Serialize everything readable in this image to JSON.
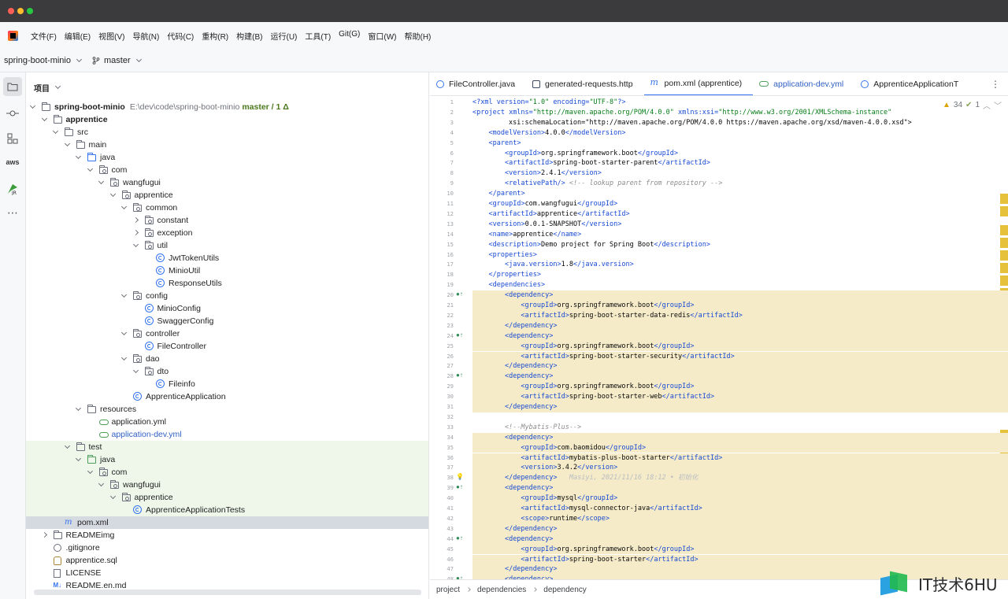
{
  "menu": [
    "文件(F)",
    "编辑(E)",
    "视图(V)",
    "导航(N)",
    "代码(C)",
    "重构(R)",
    "构建(B)",
    "运行(U)",
    "工具(T)",
    "Git(G)",
    "窗口(W)",
    "帮助(H)"
  ],
  "toolbar": {
    "project_name": "spring-boot-minio",
    "branch": "master"
  },
  "project_panel": {
    "title": "项目"
  },
  "tree": [
    {
      "depth": 0,
      "arrow": "open",
      "icon": "folder",
      "label": "spring-boot-minio",
      "bold": true,
      "hint": "E:\\dev\\code\\spring-boot-minio",
      "branch": "master / 1 Δ"
    },
    {
      "depth": 1,
      "arrow": "open",
      "icon": "folder",
      "label": "apprentice",
      "bold": true
    },
    {
      "depth": 2,
      "arrow": "open",
      "icon": "folder",
      "label": "src"
    },
    {
      "depth": 3,
      "arrow": "open",
      "icon": "folder",
      "label": "main"
    },
    {
      "depth": 4,
      "arrow": "open",
      "icon": "folder-blue",
      "label": "java"
    },
    {
      "depth": 5,
      "arrow": "open",
      "icon": "pkg",
      "label": "com"
    },
    {
      "depth": 6,
      "arrow": "open",
      "icon": "pkg",
      "label": "wangfugui"
    },
    {
      "depth": 7,
      "arrow": "open",
      "icon": "pkg",
      "label": "apprentice"
    },
    {
      "depth": 8,
      "arrow": "open",
      "icon": "pkg",
      "label": "common"
    },
    {
      "depth": 9,
      "arrow": "closed",
      "icon": "pkg",
      "label": "constant"
    },
    {
      "depth": 9,
      "arrow": "closed",
      "icon": "pkg",
      "label": "exception"
    },
    {
      "depth": 9,
      "arrow": "open",
      "icon": "pkg",
      "label": "util"
    },
    {
      "depth": 10,
      "arrow": "",
      "icon": "class",
      "label": "JwtTokenUtils"
    },
    {
      "depth": 10,
      "arrow": "",
      "icon": "class",
      "label": "MinioUtil"
    },
    {
      "depth": 10,
      "arrow": "",
      "icon": "class",
      "label": "ResponseUtils"
    },
    {
      "depth": 8,
      "arrow": "open",
      "icon": "pkg",
      "label": "config"
    },
    {
      "depth": 9,
      "arrow": "",
      "icon": "class",
      "label": "MinioConfig"
    },
    {
      "depth": 9,
      "arrow": "",
      "icon": "class",
      "label": "SwaggerConfig"
    },
    {
      "depth": 8,
      "arrow": "open",
      "icon": "pkg",
      "label": "controller"
    },
    {
      "depth": 9,
      "arrow": "",
      "icon": "class",
      "label": "FileController"
    },
    {
      "depth": 8,
      "arrow": "open",
      "icon": "pkg",
      "label": "dao"
    },
    {
      "depth": 9,
      "arrow": "open",
      "icon": "pkg",
      "label": "dto"
    },
    {
      "depth": 10,
      "arrow": "",
      "icon": "class",
      "label": "Fileinfo"
    },
    {
      "depth": 8,
      "arrow": "",
      "icon": "class",
      "label": "ApprenticeApplication"
    },
    {
      "depth": 4,
      "arrow": "open",
      "icon": "folder",
      "label": "resources"
    },
    {
      "depth": 5,
      "arrow": "",
      "icon": "yml",
      "label": "application.yml"
    },
    {
      "depth": 5,
      "arrow": "",
      "icon": "yml",
      "label": "application-dev.yml",
      "blue": true
    },
    {
      "depth": 3,
      "arrow": "open",
      "icon": "folder",
      "label": "test",
      "test": true
    },
    {
      "depth": 4,
      "arrow": "open",
      "icon": "folder-green",
      "label": "java",
      "test": true
    },
    {
      "depth": 5,
      "arrow": "open",
      "icon": "pkg",
      "label": "com",
      "test": true
    },
    {
      "depth": 6,
      "arrow": "open",
      "icon": "pkg",
      "label": "wangfugui",
      "test": true
    },
    {
      "depth": 7,
      "arrow": "open",
      "icon": "pkg",
      "label": "apprentice",
      "test": true
    },
    {
      "depth": 8,
      "arrow": "",
      "icon": "class",
      "label": "ApprenticeApplicationTests",
      "test": true
    },
    {
      "depth": 2,
      "arrow": "",
      "icon": "maven",
      "label": "pom.xml",
      "selected": true
    },
    {
      "depth": 1,
      "arrow": "closed",
      "icon": "folder",
      "label": "READMEimg"
    },
    {
      "depth": 1,
      "arrow": "",
      "icon": "git",
      "label": ".gitignore"
    },
    {
      "depth": 1,
      "arrow": "",
      "icon": "sql",
      "label": "apprentice.sql"
    },
    {
      "depth": 1,
      "arrow": "",
      "icon": "txt",
      "label": "LICENSE"
    },
    {
      "depth": 1,
      "arrow": "",
      "icon": "md",
      "label": "README.en.md"
    }
  ],
  "tabs": [
    {
      "label": "FileController.java",
      "icon": "class"
    },
    {
      "label": "generated-requests.http",
      "icon": "http"
    },
    {
      "label": "pom.xml (apprentice)",
      "icon": "maven",
      "active": true
    },
    {
      "label": "application-dev.yml",
      "icon": "yml"
    },
    {
      "label": "ApprenticeApplicationT",
      "icon": "class"
    }
  ],
  "inspection": {
    "warnings": "34",
    "weak": "1"
  },
  "code": [
    {
      "n": "1",
      "t": "<?xml version=\"1.0\" encoding=\"UTF-8\"?>"
    },
    {
      "n": "2",
      "t": "<project xmlns=\"http://maven.apache.org/POM/4.0.0\" xmlns:xsi=\"http://www.w3.org/2001/XMLSchema-instance\""
    },
    {
      "n": "3",
      "t": "         xsi:schemaLocation=\"http://maven.apache.org/POM/4.0.0 https://maven.apache.org/xsd/maven-4.0.0.xsd\">"
    },
    {
      "n": "4",
      "t": "    <modelVersion>4.0.0</modelVersion>"
    },
    {
      "n": "5",
      "t": "    <parent>"
    },
    {
      "n": "6",
      "t": "        <groupId>org.springframework.boot</groupId>"
    },
    {
      "n": "7",
      "t": "        <artifactId>spring-boot-starter-parent</artifactId>"
    },
    {
      "n": "8",
      "t": "        <version>2.4.1</version>"
    },
    {
      "n": "9",
      "t": "        <relativePath/> <!-- lookup parent from repository -->"
    },
    {
      "n": "10",
      "t": "    </parent>"
    },
    {
      "n": "11",
      "t": "    <groupId>com.wangfugui</groupId>"
    },
    {
      "n": "12",
      "t": "    <artifactId>apprentice</artifactId>"
    },
    {
      "n": "13",
      "t": "    <version>0.0.1-SNAPSHOT</version>"
    },
    {
      "n": "14",
      "t": "    <name>apprentice</name>"
    },
    {
      "n": "15",
      "t": "    <description>Demo project for Spring Boot</description>"
    },
    {
      "n": "16",
      "t": "    <properties>"
    },
    {
      "n": "17",
      "t": "        <java.version>1.8</java.version>"
    },
    {
      "n": "18",
      "t": "    </properties>"
    },
    {
      "n": "19",
      "t": "    <dependencies>"
    },
    {
      "n": "20",
      "t": "        <dependency>",
      "hl": true,
      "mark": "●↑"
    },
    {
      "n": "21",
      "t": "            <groupId>org.springframework.boot</groupId>",
      "hl": true
    },
    {
      "n": "22",
      "t": "            <artifactId>spring-boot-starter-data-redis</artifactId>",
      "hl": true
    },
    {
      "n": "23",
      "t": "        </dependency>",
      "hl": true
    },
    {
      "n": "24",
      "t": "        <dependency>",
      "hl": true,
      "mark": "●↑"
    },
    {
      "n": "25",
      "t": "            <groupId>org.springframework.boot</groupId>",
      "hl": true
    },
    {
      "n": "26",
      "t": "            <artifactId>spring-boot-starter-security</artifactId>",
      "hl": true
    },
    {
      "n": "27",
      "t": "        </dependency>",
      "hl": true
    },
    {
      "n": "28",
      "t": "        <dependency>",
      "hl": true,
      "mark": "●↑"
    },
    {
      "n": "29",
      "t": "            <groupId>org.springframework.boot</groupId>",
      "hl": true
    },
    {
      "n": "30",
      "t": "            <artifactId>spring-boot-starter-web</artifactId>",
      "hl": true
    },
    {
      "n": "31",
      "t": "        </dependency>",
      "hl": true
    },
    {
      "n": "32",
      "t": ""
    },
    {
      "n": "33",
      "t": "        <!--Mybatis-Plus-->"
    },
    {
      "n": "34",
      "t": "        <dependency>",
      "hl": true
    },
    {
      "n": "35",
      "t": "            <groupId>com.baomidou</groupId>",
      "hl": true
    },
    {
      "n": "36",
      "t": "            <artifactId>mybatis-plus-boot-starter</artifactId>",
      "hl": true
    },
    {
      "n": "37",
      "t": "            <version>3.4.2</version>",
      "hl": true
    },
    {
      "n": "38",
      "t": "        </dependency>",
      "hl": true,
      "mark": "💡",
      "inlay": "   Masiyi, 2021/11/16 18:12 • 初始化"
    },
    {
      "n": "39",
      "t": "        <dependency>",
      "hl": true,
      "mark": "●↑"
    },
    {
      "n": "40",
      "t": "            <groupId>mysql</groupId>",
      "hl": true
    },
    {
      "n": "41",
      "t": "            <artifactId>mysql-connector-java</artifactId>",
      "hl": true
    },
    {
      "n": "42",
      "t": "            <scope>runtime</scope>",
      "hl": true
    },
    {
      "n": "43",
      "t": "        </dependency>",
      "hl": true
    },
    {
      "n": "44",
      "t": "        <dependency>",
      "hl": true,
      "mark": "●↑"
    },
    {
      "n": "45",
      "t": "            <groupId>org.springframework.boot</groupId>",
      "hl": true
    },
    {
      "n": "46",
      "t": "            <artifactId>spring-boot-starter</artifactId>",
      "hl": true
    },
    {
      "n": "47",
      "t": "        </dependency>",
      "hl": true
    },
    {
      "n": "48",
      "t": "        <dependency>",
      "hl": true,
      "mark": "●↑"
    }
  ],
  "breadcrumb": [
    "project",
    "dependencies",
    "dependency"
  ],
  "watermark": "IT技术6HU",
  "colors": {
    "accent": "#3574f0",
    "highlight": "#f5ebc9",
    "xml_tag": "#174ad4",
    "xml_value": "#067d17"
  }
}
